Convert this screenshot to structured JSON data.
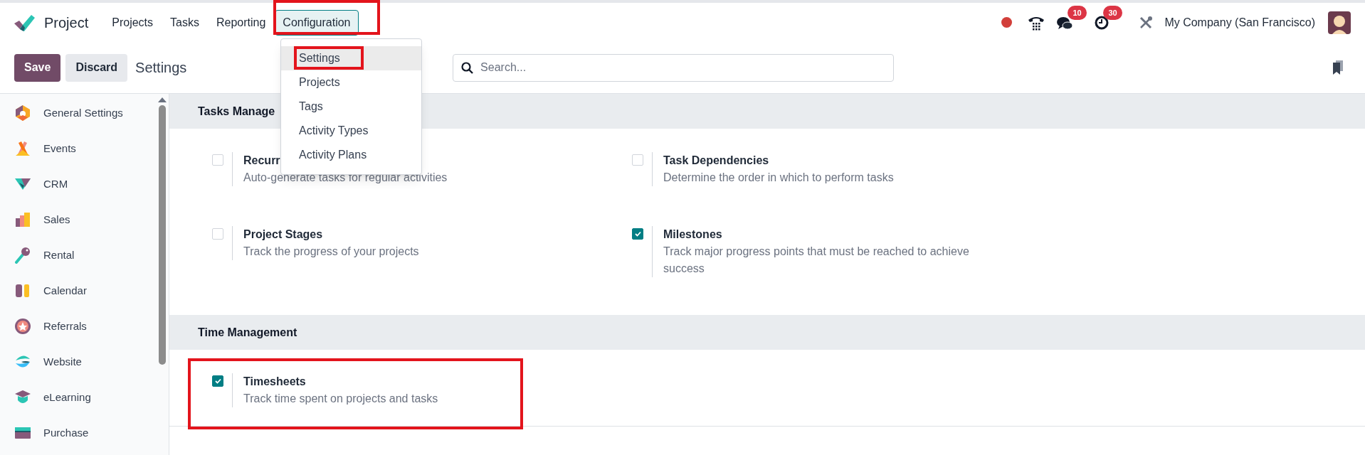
{
  "app": {
    "name": "Project"
  },
  "menu": [
    {
      "label": "Projects",
      "selected": false
    },
    {
      "label": "Tasks",
      "selected": false
    },
    {
      "label": "Reporting",
      "selected": false
    },
    {
      "label": "Configuration",
      "selected": true
    }
  ],
  "dropdown": [
    {
      "label": "Settings",
      "selected": true
    },
    {
      "label": "Projects",
      "selected": false
    },
    {
      "label": "Tags",
      "selected": false
    },
    {
      "label": "Activity Types",
      "selected": false
    },
    {
      "label": "Activity Plans",
      "selected": false
    }
  ],
  "systray": {
    "messages_count": "10",
    "activities_count": "30",
    "company": "My Company (San Francisco)"
  },
  "control_panel": {
    "save": "Save",
    "discard": "Discard",
    "breadcrumb": "Settings",
    "search": {
      "placeholder": "Search..."
    }
  },
  "sidebar": {
    "items": [
      {
        "label": "General Settings"
      },
      {
        "label": "Events"
      },
      {
        "label": "CRM"
      },
      {
        "label": "Sales"
      },
      {
        "label": "Rental"
      },
      {
        "label": "Calendar"
      },
      {
        "label": "Referrals"
      },
      {
        "label": "Website"
      },
      {
        "label": "eLearning"
      },
      {
        "label": "Purchase"
      }
    ]
  },
  "sections": [
    {
      "title": "Tasks Manage",
      "settings": [
        {
          "title": "Recurr",
          "description": "Auto-generate tasks for regular activities",
          "checked": false
        },
        {
          "title": "Task Dependencies",
          "description": "Determine the order in which to perform tasks",
          "checked": false
        },
        {
          "title": "Project Stages",
          "description": "Track the progress of your projects",
          "checked": false
        },
        {
          "title": "Milestones",
          "description": "Track major progress points that must be reached to achieve success",
          "checked": true
        }
      ]
    },
    {
      "title": "Time Management",
      "settings": [
        {
          "title": "Timesheets",
          "description": "Track time spent on projects and tasks",
          "checked": true
        }
      ]
    }
  ]
}
